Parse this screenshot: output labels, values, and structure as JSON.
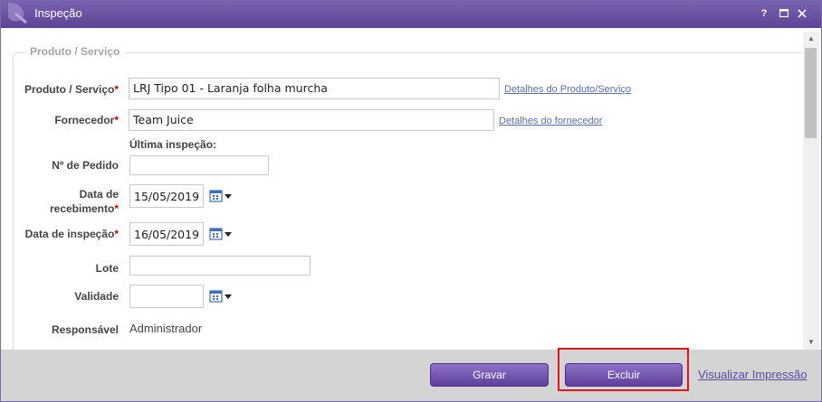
{
  "window": {
    "title": "Inspeção",
    "help_label": "?",
    "maximize_label": "□",
    "close_label": "×"
  },
  "form": {
    "legend": "Produto / Serviço",
    "product_label": "Produto / Serviço",
    "product_value": "LRJ Tipo 01 - Laranja folha murcha",
    "product_details_link": "Detalhes do Produto/Serviço",
    "supplier_label": "Fornecedor",
    "supplier_value": "Team Juice",
    "supplier_details_link": "Detalhes do fornecedor",
    "last_inspection_label": "Última inspeção:",
    "order_label": "Nº de Pedido",
    "order_value": "",
    "receipt_label_line1": "Data de",
    "receipt_label_line2": "recebimento",
    "receipt_value": "15/05/2019",
    "inspection_date_label": "Data de inspeção",
    "inspection_date_value": "16/05/2019",
    "lot_label": "Lote",
    "lot_value": "",
    "validity_label": "Validade",
    "validity_value": "",
    "responsible_label": "Responsável",
    "responsible_value": "Administrador",
    "required_marker": "*"
  },
  "footer": {
    "save_label": "Gravar",
    "delete_label": "Excluir",
    "print_link": "Visualizar Impressão"
  },
  "colors": {
    "accent": "#6a51a6",
    "required": "#cc0000",
    "highlight": "#e0161d"
  }
}
